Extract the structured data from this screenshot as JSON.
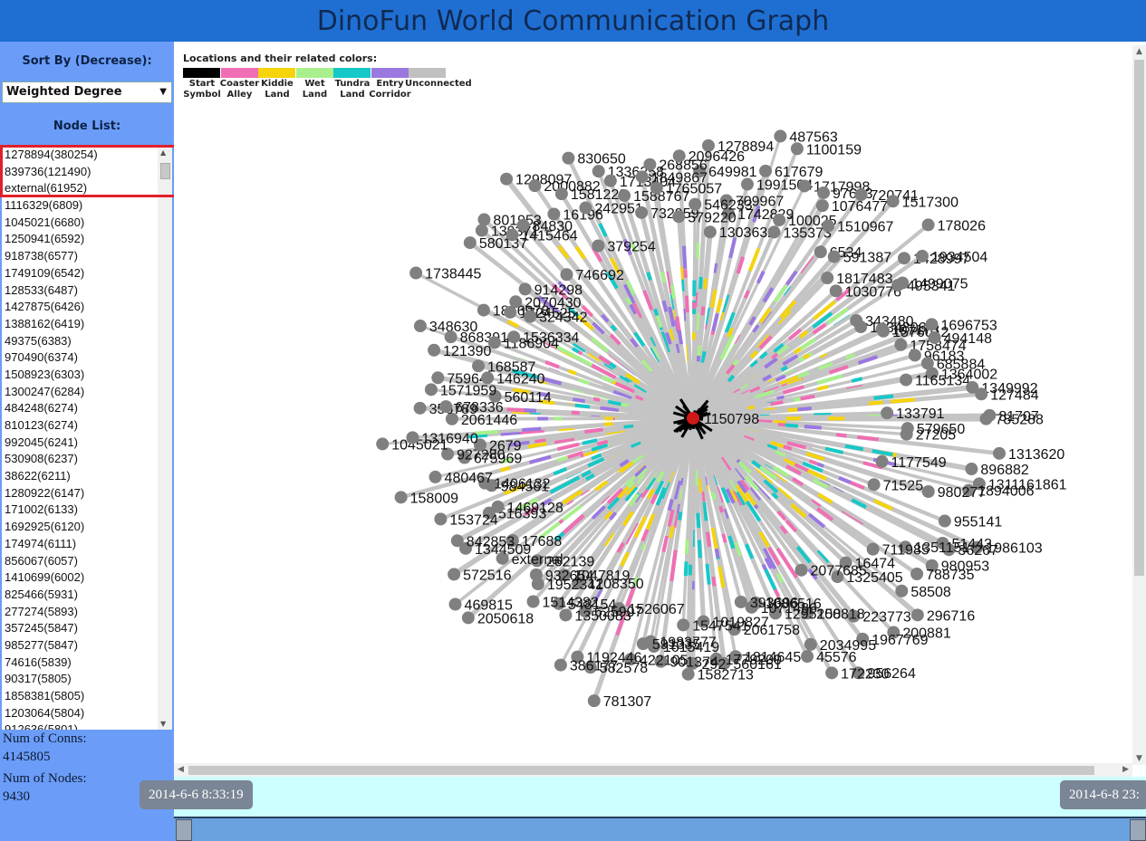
{
  "app": {
    "title": "DinoFun World Communication Graph"
  },
  "sidebar": {
    "sort_heading": "Sort By (Decrease):",
    "sort_value": "Weighted Degree",
    "node_list_heading": "Node List:",
    "nodes": [
      "1278894(380254)",
      "839736(121490)",
      "external(61952)",
      "1116329(6809)",
      "1045021(6680)",
      "1250941(6592)",
      "918738(6577)",
      "1749109(6542)",
      "128533(6487)",
      "1427875(6426)",
      "1388162(6419)",
      "49375(6383)",
      "970490(6374)",
      "1508923(6303)",
      "1300247(6284)",
      "484248(6274)",
      "810123(6274)",
      "992045(6241)",
      "530908(6237)",
      "38622(6211)",
      "1280922(6147)",
      "171002(6133)",
      "1692925(6120)",
      "174974(6111)",
      "856067(6057)",
      "1410699(6002)",
      "825466(5931)",
      "277274(5893)",
      "357245(5847)",
      "985277(5847)",
      "74616(5839)",
      "90317(5805)",
      "1858381(5805)",
      "1203064(5804)",
      "912636(5801)"
    ],
    "conns_label": "Num of Conns:",
    "conns_value": "4145805",
    "nodes_label": "Num of Nodes:",
    "nodes_value": "9430"
  },
  "legend": {
    "title": "Locations and their related colors:",
    "items": [
      {
        "label1": "Start",
        "label2": "Symbol",
        "color": "#000000"
      },
      {
        "label1": "Coaster",
        "label2": "Alley",
        "color": "#f06eb4"
      },
      {
        "label1": "Kiddie",
        "label2": "Land",
        "color": "#f5d40c"
      },
      {
        "label1": "Wet",
        "label2": "Land",
        "color": "#a8f08c"
      },
      {
        "label1": "Tundra",
        "label2": "Land",
        "color": "#16c8c8"
      },
      {
        "label1": "Entry",
        "label2": "Corridor",
        "color": "#9a78e0"
      },
      {
        "label1": "Unconnected",
        "label2": "",
        "color": "#c0c0c0"
      }
    ]
  },
  "graph": {
    "center_label": "1150798",
    "node_labels": [
      "649981",
      "1278894",
      "1303632",
      "709967",
      "1742829",
      "1991504",
      "617679",
      "487563",
      "1100159",
      "135373",
      "100025",
      "1717998",
      "97613",
      "1076477",
      "1510967",
      "720741",
      "6534",
      "591387",
      "1517300",
      "1817483",
      "1030776",
      "178026",
      "1428997",
      "1934504",
      "495341",
      "1499075",
      "343480",
      "1434806",
      "107173",
      "1576012",
      "1696753",
      "1758474",
      "494148",
      "96183",
      "685884",
      "1364002",
      "1165134",
      "1349992",
      "127484",
      "133791",
      "81707",
      "785288",
      "579650",
      "27205",
      "1313620",
      "896882",
      "1177549",
      "1311161861",
      "1894006",
      "980277",
      "71525",
      "955141",
      "1986103",
      "51443",
      "36267",
      "980953",
      "1351151",
      "788735",
      "711985",
      "58508",
      "296716",
      "16474",
      "200881",
      "1325405",
      "223773",
      "1967769",
      "2077685",
      "956264",
      "200818",
      "172230",
      "2034995",
      "45576",
      "1295158",
      "1086516",
      "1071486",
      "393696",
      "2061758",
      "1814645",
      "560161",
      "1779200",
      "1019827",
      "292",
      "1582713",
      "1547541",
      "901374",
      "1615419",
      "1983777",
      "591335",
      "422105",
      "781307",
      "1526067",
      "582578",
      "1192446",
      "386177",
      "625907",
      "1350083",
      "1208350",
      "548154",
      "1047819",
      "1514382",
      "1952341",
      "932654",
      "262139",
      "2050618",
      "469815",
      "external",
      "17688",
      "572516",
      "1344509",
      "842853",
      "516393",
      "1469128",
      "153724",
      "984561",
      "1406132",
      "158009",
      "480467",
      "675969",
      "927280",
      "2679",
      "1045021",
      "1316940",
      "2061446",
      "356789",
      "678336",
      "560114",
      "1571959",
      "75964",
      "146240",
      "168587",
      "121390",
      "348630",
      "868391",
      "1186904",
      "1536334",
      "1846978",
      "1738445",
      "1724525",
      "324342",
      "2070430",
      "914298",
      "580137",
      "139371",
      "801953",
      "1415464",
      "84830",
      "746692",
      "1298097",
      "16196",
      "2000882",
      "1581223",
      "379254",
      "242951",
      "830650",
      "1336258",
      "1713404",
      "1588767",
      "732959",
      "1849867",
      "268856",
      "1765057",
      "579220",
      "2096426",
      "546233"
    ]
  }
}
